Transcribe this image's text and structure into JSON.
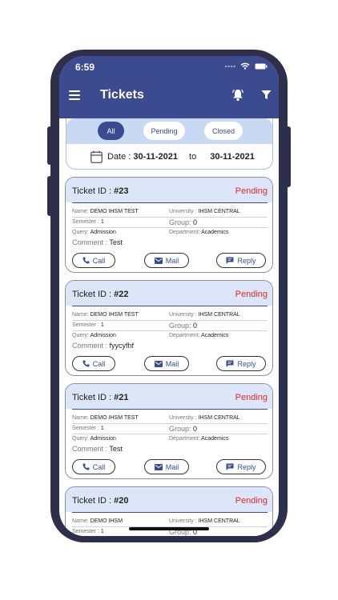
{
  "status_bar": {
    "time": "6:59"
  },
  "header": {
    "title": "Tickets"
  },
  "tabs": [
    {
      "label": "All"
    },
    {
      "label": "Pending"
    },
    {
      "label": "Closed"
    }
  ],
  "date_filter": {
    "label": "Date :",
    "from": "30-11-2021",
    "to_label": "to",
    "to": "30-11-2021"
  },
  "labels": {
    "ticket_id": "Ticket ID :",
    "name": "Name:",
    "university": "University :",
    "semester": "Semester :",
    "group": "Group:",
    "query": "Query:",
    "department": "Department:",
    "comment": "Comment :",
    "call": "Call",
    "mail": "Mail",
    "reply": "Reply"
  },
  "tickets": [
    {
      "id": "#23",
      "status": "Pending",
      "name": "DEMO IHSM TEST",
      "university": "IHSM CENTRAL",
      "semester": "1",
      "group": "0",
      "query": "Admission",
      "department": "Academics",
      "comment": "Test"
    },
    {
      "id": "#22",
      "status": "Pending",
      "name": "DEMO IHSM TEST",
      "university": "IHSM CENTRAL",
      "semester": "1",
      "group": "0",
      "query": "Admission",
      "department": "Academics",
      "comment": "fyycyfhf"
    },
    {
      "id": "#21",
      "status": "Pending",
      "name": "DEMO IHSM TEST",
      "university": "IHSM CENTRAL",
      "semester": "1",
      "group": "0",
      "query": "Admission",
      "department": "Academics",
      "comment": "Test"
    },
    {
      "id": "#20",
      "status": "Pending",
      "name": "DEMO IHSM",
      "university": "IHSM CENTRAL",
      "semester": "1",
      "group": "0",
      "query": "",
      "department": "",
      "comment": ""
    }
  ],
  "colors": {
    "primary": "#3c4a8f",
    "pending": "#e0272e",
    "tab_bar": "#c9d8f3",
    "ticket_header": "#dde6f8",
    "phone_frame": "#2e2f4a"
  }
}
